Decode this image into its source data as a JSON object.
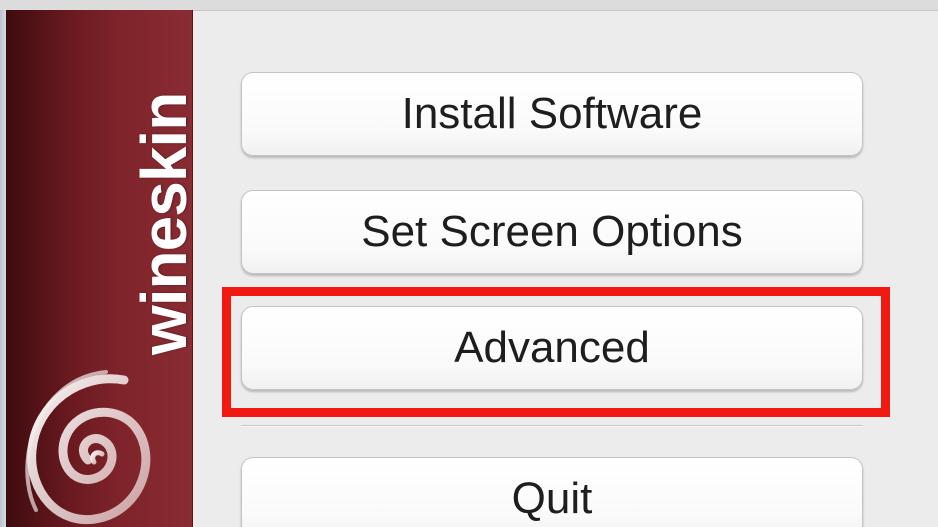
{
  "brand": {
    "name": "wineskin",
    "logo_icon": "spiral-logo-icon"
  },
  "menu": {
    "install_label": "Install Software",
    "screen_label": "Set Screen Options",
    "advanced_label": "Advanced",
    "quit_label": "Quit"
  },
  "annotation": {
    "highlight_color": "#f11a12",
    "highlighted_item": "Advanced"
  }
}
